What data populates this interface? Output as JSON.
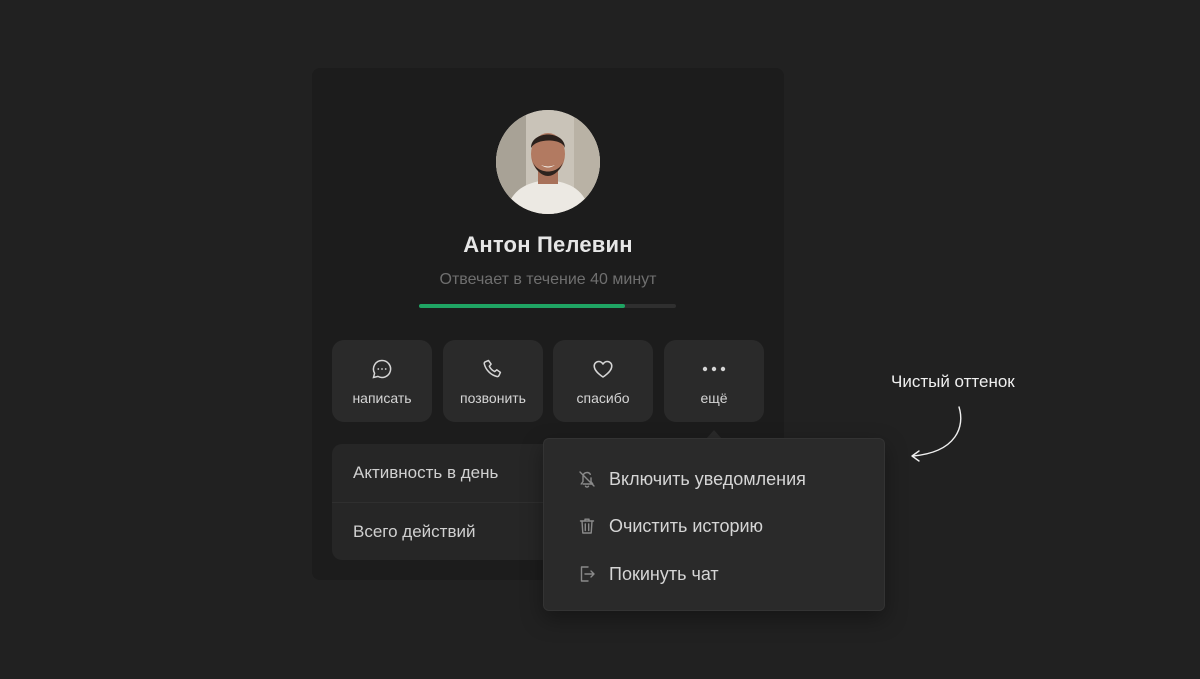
{
  "profile": {
    "name": "Антон Пелевин",
    "status": "Отвечает в течение 40 минут",
    "response_progress": 0.8,
    "progress_color": "#1fa463"
  },
  "actions": [
    {
      "label": "написать",
      "icon": "message-icon"
    },
    {
      "label": "позвонить",
      "icon": "phone-icon"
    },
    {
      "label": "спасибо",
      "icon": "heart-icon"
    },
    {
      "label": "ещё",
      "icon": "more-icon"
    }
  ],
  "stats": [
    {
      "label": "Активность в день"
    },
    {
      "label": "Всего действий"
    }
  ],
  "menu": {
    "items": [
      {
        "label": "Включить уведомления",
        "icon": "bell-off-icon"
      },
      {
        "label": "Очистить историю",
        "icon": "trash-icon"
      },
      {
        "label": "Покинуть чат",
        "icon": "exit-icon"
      }
    ]
  },
  "annotation": {
    "text": "Чистый оттенок"
  },
  "colors": {
    "background": "#212121",
    "card": "#1c1c1c",
    "surface": "#2a2a2a",
    "accent": "#1fa463"
  }
}
